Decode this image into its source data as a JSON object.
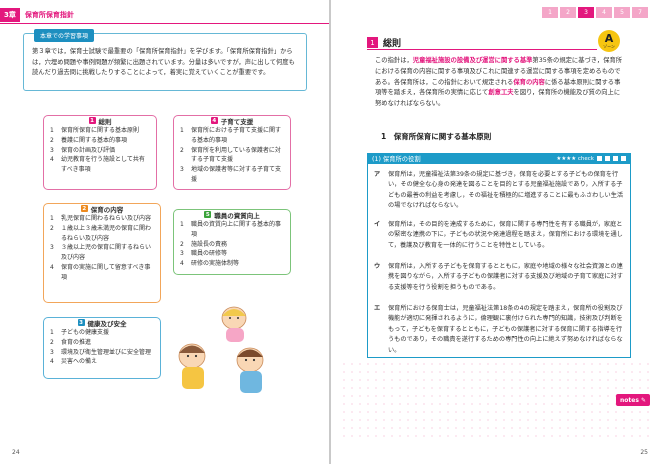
{
  "left_page": {
    "chapter_number": "3章",
    "chapter_title": "保育所保育指針",
    "page_number": "24",
    "study_box": {
      "label": "本章での学習事項",
      "text": "第３章では，保育士試験で最重要の「保育所保育指針」を学びます。「保育所保育指針」からは，穴埋め問題や事例問題が頻繁に出題されています。分量は多いですが，声に出して何度も読んだり過去問に挑戦したりすることによって，着実に覚えていくことが重要です。"
    },
    "boxes": [
      {
        "num": "1",
        "title": "総則",
        "items": [
          {
            "k": "1",
            "t": "保育所保育に関する基本原則"
          },
          {
            "k": "2",
            "t": "養護に関する基本的事項"
          },
          {
            "k": "3",
            "t": "保育の計画及び評価"
          },
          {
            "k": "4",
            "t": "幼児教育を行う施設として共有すべき事項"
          }
        ]
      },
      {
        "num": "4",
        "title": "子育て支援",
        "items": [
          {
            "k": "1",
            "t": "保育所における子育て支援に関する基本的事項"
          },
          {
            "k": "2",
            "t": "保育所を利用している保護者に対する子育て支援"
          },
          {
            "k": "3",
            "t": "地域の保護者等に対する子育て支援"
          }
        ]
      },
      {
        "num": "2",
        "title": "保育の内容",
        "items": [
          {
            "k": "1",
            "t": "乳児保育に関わるねらい及び内容"
          },
          {
            "k": "2",
            "t": "１歳以上３歳未満児の保育に関わるねらい及び内容"
          },
          {
            "k": "3",
            "t": "３歳以上児の保育に関するねらい及び内容"
          },
          {
            "k": "4",
            "t": "保育の実施に関して留意すべき事項"
          }
        ]
      },
      {
        "num": "5",
        "title": "職員の資質向上",
        "items": [
          {
            "k": "1",
            "t": "職員の資質向上に関する基本的事項"
          },
          {
            "k": "2",
            "t": "施設長の責務"
          },
          {
            "k": "3",
            "t": "職員の研修等"
          },
          {
            "k": "4",
            "t": "研修の実施体制等"
          }
        ]
      },
      {
        "num": "3",
        "title": "健康及び安全",
        "items": [
          {
            "k": "1",
            "t": "子どもの健康支援"
          },
          {
            "k": "2",
            "t": "食育の推進"
          },
          {
            "k": "3",
            "t": "環境及び衛生管理並びに安全管理"
          },
          {
            "k": "4",
            "t": "災害への備え"
          }
        ]
      }
    ]
  },
  "right_page": {
    "page_number": "25",
    "section_number": "1",
    "section_title": "総則",
    "zone": {
      "letter": "A",
      "label": "ゾーン"
    },
    "intro": {
      "p1": "この指針は，",
      "p1_hl": "児童福祉施設の設備及び運営に関する基準",
      "p1b": "第35条の規定に基づき，保育所における保育の内容に関する事項及びこれに関連する運営に関する事項を定めるものである。各保育所は，この指針において規定される",
      "p1_hl2": "保育の内容",
      "p1c": "に係る基本原則に関する事項等を踏まえ，各保育所の実情に応じて",
      "p1_hl3": "創意工夫",
      "p1d": "を図り，保育所の機能及び質の向上に努めなければならない。"
    },
    "subhead": "1　保育所保育に関する基本原則",
    "bar": {
      "title": "(1) 保育所の役割",
      "check": "★★★★ check"
    },
    "items": [
      {
        "k": "ア",
        "t": "保育所は，児童福祉法第39条の規定に基づき，保育を必要とする子どもの保育を行い，その健全な心身の発達を図ることを目的とする児童福祉施設であり，入所する子どもの最善の利益を考慮し，その福祉を積極的に増進することに最もふさわしい生活の場でなければならない。"
      },
      {
        "k": "イ",
        "t": "保育所は，その目的を達成するために，保育に関する専門性を有する職員が，家庭との緊密な連携の下に，子どもの状況や発達過程を踏まえ，保育所における環境を通して，養護及び教育を一体的に行うことを特性としている。"
      },
      {
        "k": "ウ",
        "t": "保育所は，入所する子どもを保育するとともに，家庭や地域の様々な社会資源との連携を図りながら，入所する子どもの保護者に対する支援及び地域の子育て家庭に対する支援等を行う役割を担うものである。"
      },
      {
        "k": "エ",
        "t": "保育所における保育士は，児童福祉法第18条の4の規定を踏まえ，保育所の役割及び機能が適切に発揮されるように，倫理観に裏付けられた専門的知識，技術及び判断をもって，子どもを保育するとともに，子どもの保護者に対する保育に関する指導を行うものであり，その職責を遂行するための専門性の向上に絶えず努めなければならない。"
      }
    ],
    "notes": "notes"
  },
  "progress": [
    "1",
    "2",
    "3",
    "4",
    "5",
    "7"
  ],
  "colors": {
    "accent": "#e3177d",
    "blue": "#1d8fc0",
    "orange": "#ee8a1e",
    "green": "#3aa33a"
  }
}
